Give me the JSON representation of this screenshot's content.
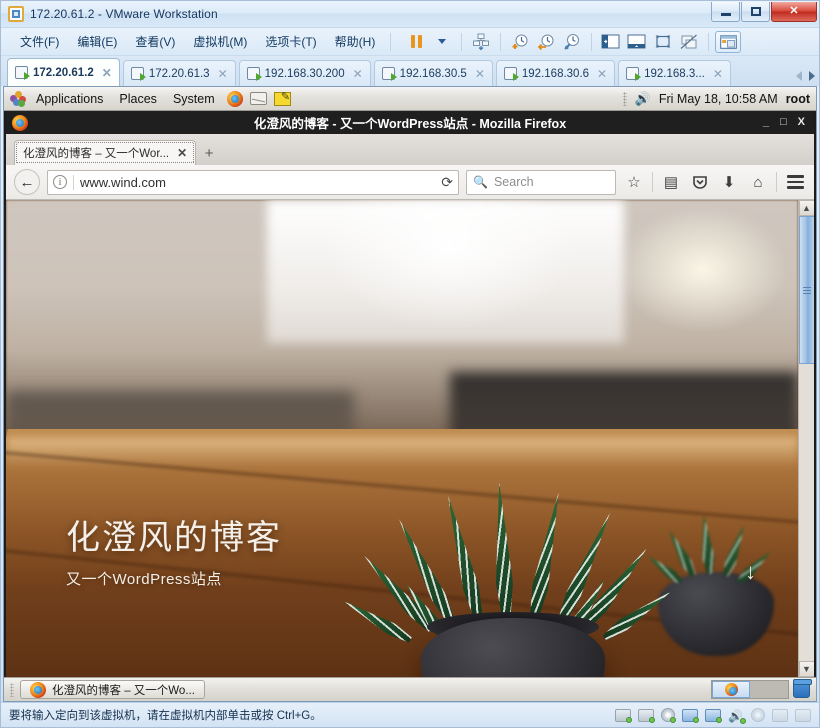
{
  "vmware": {
    "title": "172.20.61.2 - VMware Workstation",
    "app_icon": "vmware-icon",
    "window_buttons": {
      "minimize": "–",
      "maximize": "□",
      "close": "✕"
    },
    "menus": [
      {
        "label": "文件(F)",
        "key": "F"
      },
      {
        "label": "编辑(E)",
        "key": "E"
      },
      {
        "label": "查看(V)",
        "key": "V"
      },
      {
        "label": "虚拟机(M)",
        "key": "M"
      },
      {
        "label": "选项卡(T)",
        "key": "T"
      },
      {
        "label": "帮助(H)",
        "key": "H"
      }
    ],
    "toolbar": [
      {
        "name": "suspend-button",
        "icon": "pause-icon"
      },
      {
        "name": "suspend-dropdown",
        "icon": "chevron-down-icon"
      },
      {
        "name": "manage-snapshots-button",
        "icon": "snapshot-manager-icon"
      },
      {
        "name": "take-snapshot-button",
        "icon": "snapshot-add-icon"
      },
      {
        "name": "revert-snapshot-button",
        "icon": "snapshot-revert-icon"
      },
      {
        "name": "snapshot-manager-button",
        "icon": "snapshot-settings-icon"
      },
      {
        "name": "show-library-button",
        "icon": "sidebar-panel-icon"
      },
      {
        "name": "show-thumbnail-bar-button",
        "icon": "thumbnail-bar-icon"
      },
      {
        "name": "enter-fullscreen-button",
        "icon": "fullscreen-icon"
      },
      {
        "name": "unity-mode-button",
        "icon": "unity-mode-icon"
      },
      {
        "name": "console-view-button",
        "icon": "console-view-icon"
      }
    ],
    "tabs": [
      {
        "label": "172.20.61.2",
        "active": true
      },
      {
        "label": "172.20.61.3",
        "active": false
      },
      {
        "label": "192.168.30.200",
        "active": false
      },
      {
        "label": "192.168.30.5",
        "active": false
      },
      {
        "label": "192.168.30.6",
        "active": false
      },
      {
        "label": "192.168.3...",
        "active": false
      }
    ],
    "status_message": "要将输入定向到该虚拟机，请在虚拟机内部单击或按 Ctrl+G。",
    "devices": [
      {
        "name": "hard-disk-1-icon"
      },
      {
        "name": "hard-disk-2-icon"
      },
      {
        "name": "cd-dvd-icon"
      },
      {
        "name": "network-adapter-1-icon"
      },
      {
        "name": "network-adapter-2-icon"
      },
      {
        "name": "sound-card-icon"
      },
      {
        "name": "usb-icon"
      },
      {
        "name": "printer-icon"
      },
      {
        "name": "display-icon"
      }
    ]
  },
  "guest": {
    "top_panel": {
      "applications": "Applications",
      "places": "Places",
      "system": "System",
      "launchers": [
        "firefox-launcher-icon",
        "evolution-mail-icon",
        "text-editor-icon"
      ],
      "clock": "Fri May 18, 10:58 AM",
      "user": "root",
      "volume_icon": "speaker-icon"
    },
    "firefox": {
      "window_title": "化澄风的博客 - 又一个WordPress站点 - Mozilla Firefox",
      "window_buttons": {
        "minimize": "_",
        "maximize": "□",
        "close": "X"
      },
      "tab": {
        "label": "化澄风的博客 – 又一个Wor...",
        "close": "✕"
      },
      "new_tab": "+",
      "url": "www.wind.com",
      "url_prefix": "www.",
      "url_domain": "wind.com",
      "search_placeholder": "Search",
      "reload_label": "⟳",
      "toolbar_icons": [
        {
          "name": "bookmark-star-icon",
          "glyph": "☆"
        },
        {
          "name": "reader-list-icon",
          "glyph": "▤"
        },
        {
          "name": "pocket-icon",
          "glyph": "▼"
        },
        {
          "name": "downloads-icon",
          "glyph": "⬇"
        },
        {
          "name": "home-icon",
          "glyph": "⌂"
        },
        {
          "name": "menu-hamburger-icon",
          "glyph": "☰"
        }
      ]
    },
    "webpage": {
      "site_title": "化澄风的博客",
      "tagline": "又一个WordPress站点",
      "scroll_hint": "↓",
      "hero_image": "potted-zebra-haworthia-on-wooden-table"
    },
    "taskbar": {
      "window_button": "化澄风的博客 – 又一个Wo...",
      "workspaces": [
        "workspace-1",
        "workspace-2"
      ],
      "trash": "trash-icon"
    }
  }
}
